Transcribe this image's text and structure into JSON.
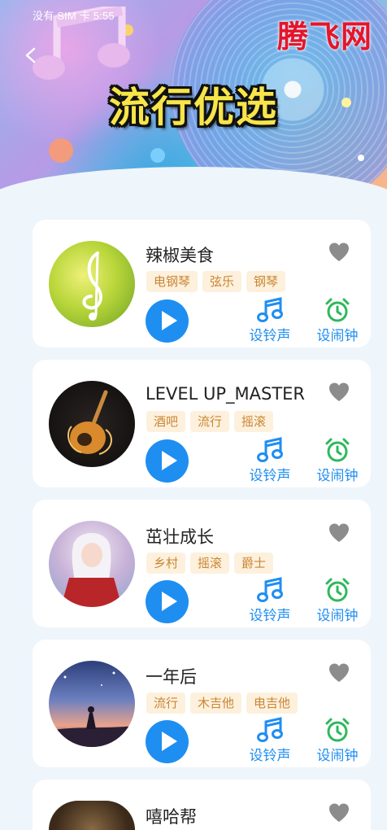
{
  "header": {
    "status_text": "没有 SIM 卡 5:55",
    "logo_text": "腾飞网",
    "title": "流行优选"
  },
  "actions": {
    "set_ringtone_label": "设铃声",
    "set_alarm_label": "设闹钟"
  },
  "colors": {
    "accent": "#1f8ef1",
    "alarm_icon": "#2eb85c",
    "tag_bg": "#fdf1dd",
    "tag_text": "#c98533",
    "heart": "#8c8c8c",
    "logo": "#e5152b",
    "title_fill": "#f7e54a"
  },
  "songs": [
    {
      "title": "辣椒美食",
      "tags": [
        "电钢琴",
        "弦乐",
        "钢琴"
      ],
      "cover_icon": "treble-clef-green-cover"
    },
    {
      "title": "LEVEL UP_MASTER",
      "tags": [
        "酒吧",
        "流行",
        "摇滚"
      ],
      "cover_icon": "guitar-cover"
    },
    {
      "title": "茁壮成长",
      "tags": [
        "乡村",
        "摇滚",
        "爵士"
      ],
      "cover_icon": "anime-girl-cover"
    },
    {
      "title": "一年后",
      "tags": [
        "流行",
        "木吉他",
        "电吉他"
      ],
      "cover_icon": "sunset-silhouette-cover"
    },
    {
      "title": "嘻哈帮",
      "tags": [],
      "cover_icon": "partial-cover"
    }
  ]
}
